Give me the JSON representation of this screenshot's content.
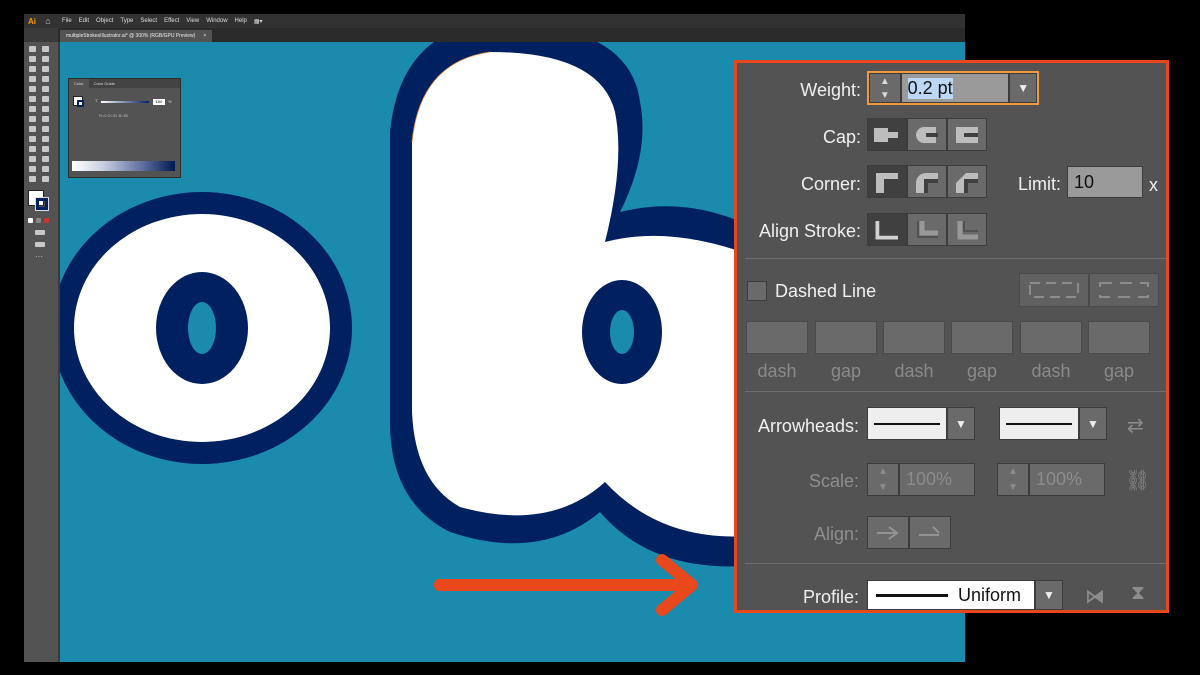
{
  "app": {
    "logo": "Ai",
    "home_icon": "home-icon",
    "menu": [
      "File",
      "Edit",
      "Object",
      "Type",
      "Select",
      "Effect",
      "View",
      "Window",
      "Help"
    ],
    "document_tab": "multipleStrokesIllustrator.ai* @ 300% (RGB/GPU Preview)",
    "tab_close": "×"
  },
  "color_panel": {
    "tabs": [
      "Color",
      "Color Guide"
    ],
    "channel_label": "T",
    "tint_value": "100",
    "percent": "%",
    "readout": "R=0 G=31 B=80"
  },
  "stroke_panel": {
    "weight_label": "Weight:",
    "weight_value": "0.2 pt",
    "cap_label": "Cap:",
    "corner_label": "Corner:",
    "limit_label": "Limit:",
    "limit_value": "10",
    "limit_unit": "x",
    "align_label": "Align Stroke:",
    "dashed_label": "Dashed Line",
    "dash_labels": [
      "dash",
      "gap",
      "dash",
      "gap",
      "dash",
      "gap"
    ],
    "arrowheads_label": "Arrowheads:",
    "scale_label": "Scale:",
    "scale_start": "100%",
    "scale_end": "100%",
    "align_arrow_label": "Align:",
    "profile_label": "Profile:",
    "profile_value": "Uniform"
  },
  "colors": {
    "accent": "#e8481c",
    "canvas": "#1a8aad",
    "outline": "#002060"
  }
}
